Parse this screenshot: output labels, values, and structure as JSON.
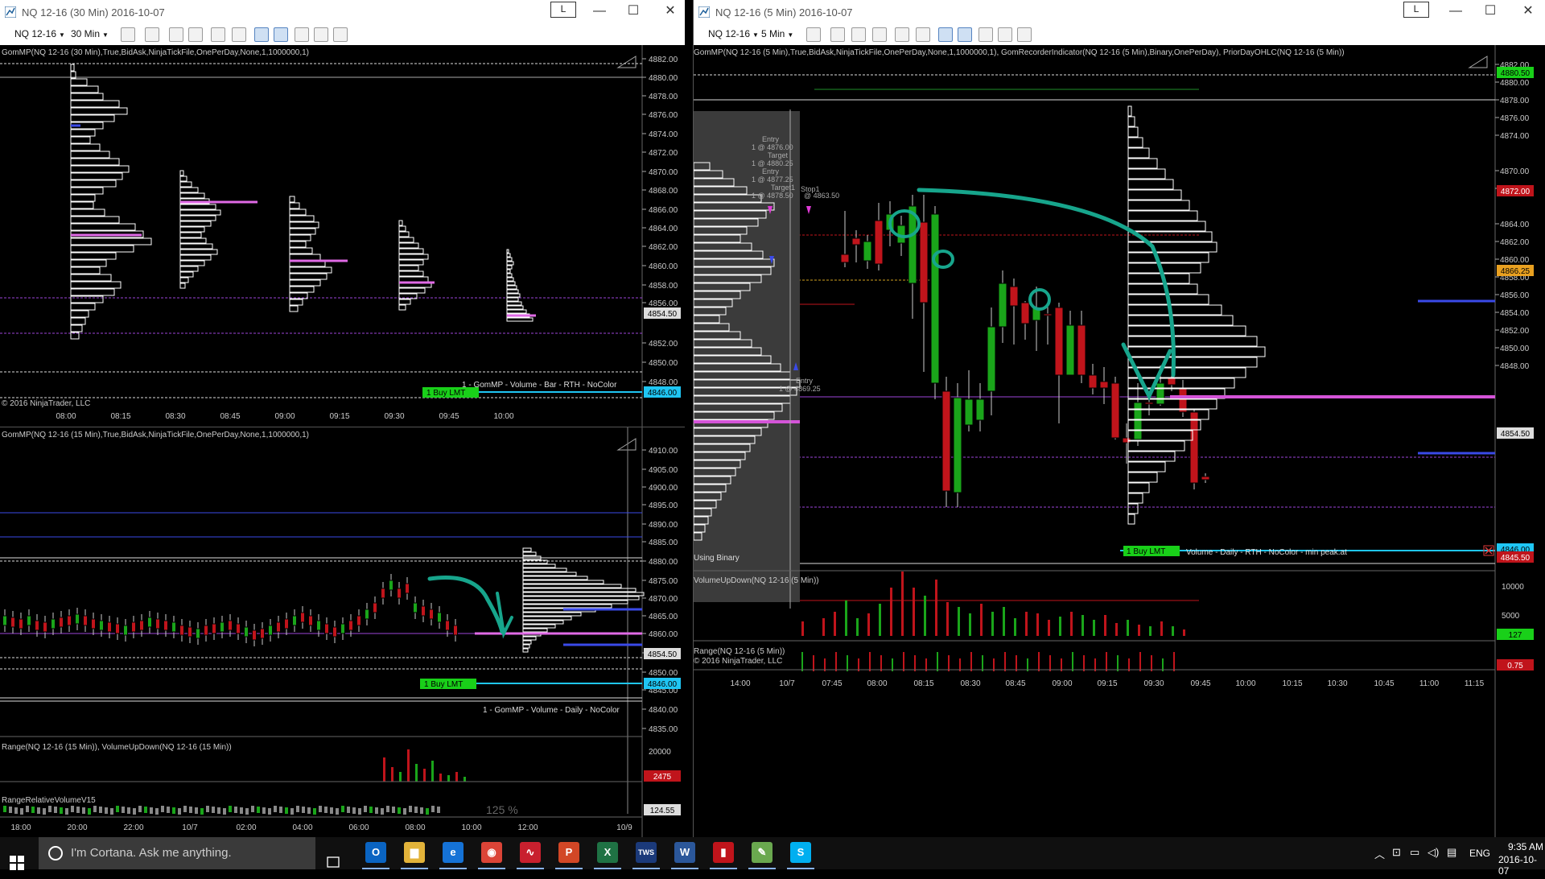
{
  "left_top": {
    "title": "NQ 12-16 (30 Min)  2016-10-07",
    "lbtn": "L",
    "instrument": "NQ 12-16",
    "interval": "30 Min",
    "indicator_label": "GomMP(NQ 12-16 (30 Min),True,BidAsk,NinjaTickFile,OnePerDay,None,1,1000000,1)",
    "copyright": "© 2016 NinjaTrader, LLC",
    "order_label": "1  Buy LMT",
    "profile_label": "1 - GomMP - Volume - Bar - RTH - NoColor",
    "price_axis": [
      "4882.00",
      "4880.00",
      "4878.00",
      "4876.00",
      "4874.00",
      "4872.00",
      "4870.00",
      "4868.00",
      "4866.00",
      "4864.00",
      "4862.00",
      "4860.00",
      "4858.00",
      "4856.00",
      "4852.00",
      "4850.00",
      "4848.00"
    ],
    "price_current": "4854.50",
    "price_order": "4846.00",
    "time_axis": [
      "08:00",
      "08:15",
      "08:30",
      "08:45",
      "09:00",
      "09:15",
      "09:30",
      "09:45",
      "10:00"
    ]
  },
  "left_bottom": {
    "indicator_label": "GomMP(NQ 12-16 (15 Min),True,BidAsk,NinjaTickFile,OnePerDay,None,1,1000000,1)",
    "order_label": "1  Buy LMT",
    "profile_label": "1 - GomMP - Volume - Daily - NoColor",
    "price_axis": [
      "4910.00",
      "4905.00",
      "4900.00",
      "4895.00",
      "4890.00",
      "4885.00",
      "4880.00",
      "4875.00",
      "4870.00",
      "4865.00",
      "4860.00",
      "4855.00",
      "4850.00",
      "4845.00",
      "4840.00",
      "4835.00"
    ],
    "price_current": "4854.50",
    "price_order": "4846.00",
    "range_label": "Range(NQ 12-16 (15 Min)), VolumeUpDown(NQ 12-16 (15 Min))",
    "range_axis": "20000",
    "range_value": "2475",
    "relvol_label": "RangeRelativeVolumeV15",
    "relvol_pct": "125 %",
    "relvol_value": "124.55",
    "time_axis": [
      "18:00",
      "20:00",
      "22:00",
      "10/7",
      "02:00",
      "04:00",
      "06:00",
      "08:00",
      "10:00",
      "12:00",
      "10/9"
    ]
  },
  "right": {
    "title": "NQ 12-16 (5 Min)  2016-10-07",
    "lbtn": "L",
    "instrument": "NQ 12-16",
    "interval": "5 Min",
    "indicator_label": "GomMP(NQ 12-16 (5 Min),True,BidAsk,NinjaTickFile,OnePerDay,None,1,1000000,1), GomRecorderIndicator(NQ 12-16 (5 Min),Binary,OnePerDay), PriorDayOHLC(NQ 12-16 (5 Min))",
    "using_binary": "Using Binary",
    "order_label": "1  Buy LMT",
    "profile_label": "Volume - Daily - RTH - NoColor - min peak.at",
    "annotations": [
      "Entry",
      "1 @ 4876.00",
      "Target",
      "1 @ 4880.25",
      "Entry",
      "1 @ 4877.25",
      "Target1",
      "1 @ 4878.50",
      "Stop1",
      "@ 4863.50",
      "Entry",
      "1 @ 4869.25"
    ],
    "price_axis": [
      "4882.00",
      "4880.00",
      "4878.00",
      "4876.00",
      "4874.00",
      "4870.00",
      "4868.00",
      "4864.00",
      "4862.00",
      "4860.00",
      "4858.00",
      "4856.00",
      "4854.00",
      "4852.00",
      "4850.00",
      "4848.00"
    ],
    "price_high": "4880.50",
    "price_red": "4872.00",
    "price_orange": "4866.25",
    "price_current": "4854.50",
    "price_order": "4846.00",
    "price_red2": "4845.50",
    "vol_label": "VolumeUpDown(NQ 12-16 (5 Min))",
    "vol_axis": [
      "10000",
      "5000"
    ],
    "vol_value": "127",
    "range_label": "Range(NQ 12-16 (5 Min))",
    "copyright": "© 2016 NinjaTrader, LLC",
    "range_value": "0.75",
    "time_axis": [
      "14:00",
      "10/7",
      "07:45",
      "08:00",
      "08:15",
      "08:30",
      "08:45",
      "09:00",
      "09:15",
      "09:30",
      "09:45",
      "10:00",
      "10:15",
      "10:30",
      "10:45",
      "11:00",
      "11:15"
    ]
  },
  "window_controls": {
    "min": "—",
    "max": "☐",
    "close": "✕"
  },
  "taskbar": {
    "search_placeholder": "I'm Cortana. Ask me anything.",
    "apps": [
      {
        "name": "Outlook",
        "glyph": "O",
        "color": "#0a64c2"
      },
      {
        "name": "File Explorer",
        "glyph": "▆",
        "color": "#e2b33a"
      },
      {
        "name": "Edge",
        "glyph": "e",
        "color": "#1572d6"
      },
      {
        "name": "Chrome",
        "glyph": "◉",
        "color": "#db4437"
      },
      {
        "name": "NinjaTrader",
        "glyph": "∿",
        "color": "#c8202e"
      },
      {
        "name": "PowerPoint",
        "glyph": "P",
        "color": "#d24726"
      },
      {
        "name": "Excel",
        "glyph": "X",
        "color": "#1f7244"
      },
      {
        "name": "TWS",
        "glyph": "TWS",
        "color": "#1b3a7a"
      },
      {
        "name": "Word",
        "glyph": "W",
        "color": "#2b579a"
      },
      {
        "name": "App",
        "glyph": "▮",
        "color": "#c0141b"
      },
      {
        "name": "Tool",
        "glyph": "✎",
        "color": "#6aa84f"
      },
      {
        "name": "Skype",
        "glyph": "S",
        "color": "#00aff0"
      }
    ],
    "lang": "ENG",
    "time": "9:35 AM",
    "date": "2016-10-07"
  }
}
